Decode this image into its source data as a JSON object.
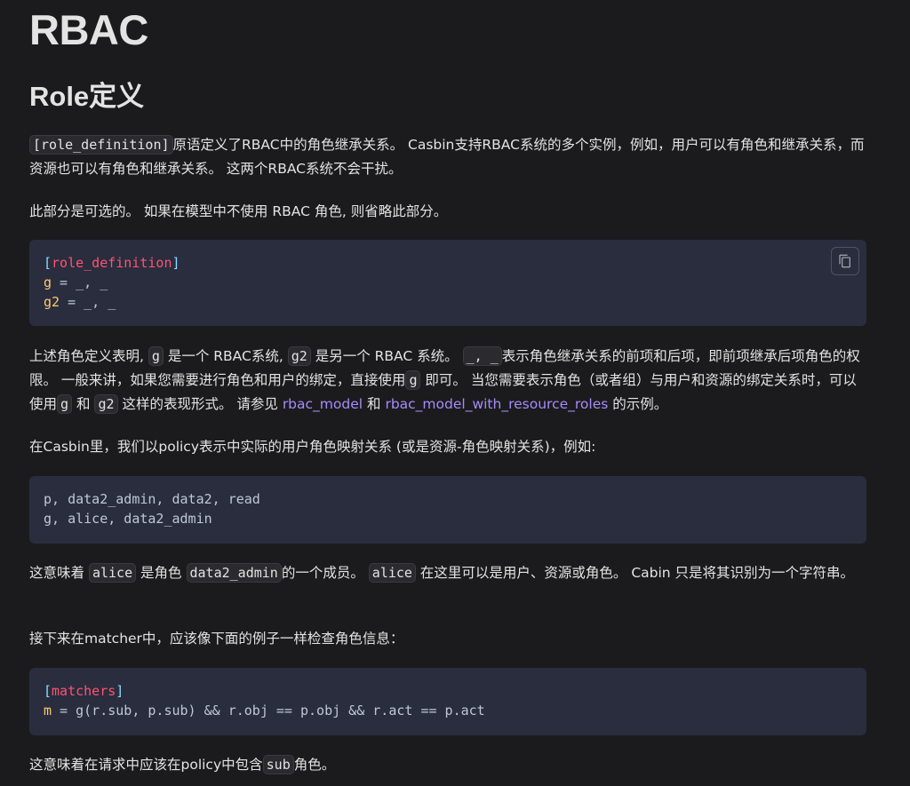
{
  "page": {
    "title": "RBAC",
    "subtitle": "Role定义"
  },
  "p1": {
    "code": "[role_definition]",
    "text": "原语定义了RBAC中的角色继承关系。 Casbin支持RBAC系统的多个实例，例如，用户可以有角色和继承关系，而资源也可以有角色和继承关系。 这两个RBAC系统不会干扰。"
  },
  "p2": {
    "text": "此部分是可选的。 如果在模型中不使用 RBAC 角色, 则省略此部分。"
  },
  "code1": {
    "line1_open": "[",
    "line1_section": "role_definition",
    "line1_close": "]",
    "line2_key": "g",
    "line2_rest": " = _, _",
    "line3_key": "g2",
    "line3_rest": " = _, _",
    "copy_icon": "copy-icon"
  },
  "p3": {
    "t1": "上述角色定义表明,",
    "c1": "g",
    "t2": "是一个 RBAC系统,",
    "c2": "g2",
    "t3": "是另一个 RBAC 系统。",
    "c3": "_, _",
    "t4": "表示角色继承关系的前项和后项，即前项继承后项角色的权限。 一般来讲，如果您需要进行角色和用户的绑定，直接使用",
    "c4": "g",
    "t5": "即可。 当您需要表示角色（或者组）与用户和资源的绑定关系时，可以使用",
    "c5": "g",
    "t6": "和",
    "c6": "g2",
    "t7": "这样的表现形式。 请参见",
    "link1": "rbac_model",
    "t8": "和",
    "link2": "rbac_model_with_resource_roles",
    "t9": "的示例。"
  },
  "p4": {
    "text": "在Casbin里，我们以policy表示中实际的用户角色映射关系 (或是资源-角色映射关系)，例如:"
  },
  "code2": {
    "line1": "p, data2_admin, data2, read",
    "line2": "g, alice, data2_admin"
  },
  "p5": {
    "t1": "这意味着",
    "c1": "alice",
    "t2": "是角色",
    "c2": "data2_admin",
    "t3": "的一个成员。",
    "c3": "alice",
    "t4": "在这里可以是用户、资源或角色。 Cabin 只是将其识别为一个字符串。"
  },
  "p6": {
    "text": "接下来在matcher中，应该像下面的例子一样检查角色信息："
  },
  "code3": {
    "line1_open": "[",
    "line1_section": "matchers",
    "line1_close": "]",
    "line2_key": "m",
    "line2_rest": " = g(r.sub, p.sub) && r.obj == p.obj && r.act == p.act"
  },
  "p7": {
    "t1": "这意味着在请求中应该在policy中包含",
    "c1": "sub",
    "t2": "角色。"
  }
}
